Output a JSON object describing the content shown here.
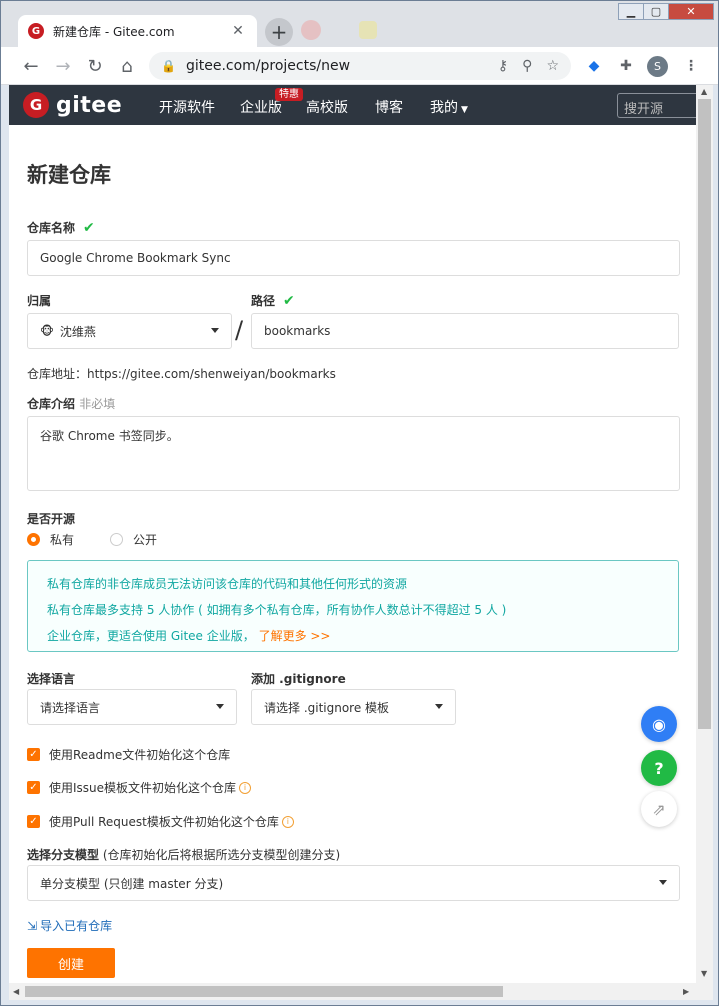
{
  "browser": {
    "tab_title": "新建仓库 - Gitee.com",
    "favicon_letter": "G",
    "url": "gitee.com/projects/new",
    "profile_initial": "S"
  },
  "site_nav": {
    "logo_text": "gitee",
    "logo_letter": "G",
    "items": [
      "开源软件",
      "企业版",
      "高校版",
      "博客",
      "我的"
    ],
    "badge": "特惠",
    "search_placeholder": "搜开源"
  },
  "form": {
    "title": "新建仓库",
    "repo_name_label": "仓库名称",
    "repo_name_value": "Google Chrome Bookmark Sync",
    "owner_label": "归属",
    "owner_value": "沈维燕",
    "path_label": "路径",
    "path_value": "bookmarks",
    "slash": "/",
    "address_label": "仓库地址：",
    "address_value": "https://gitee.com/shenweiyan/bookmarks",
    "desc_label": "仓库介绍",
    "desc_optional": "非必填",
    "desc_value": "谷歌 Chrome 书签同步。",
    "open_label": "是否开源",
    "radio_private": "私有",
    "radio_public": "公开",
    "info_lines": [
      "私有仓库的非仓库成员无法访问该仓库的代码和其他任何形式的资源",
      "私有仓库最多支持 5 人协作 ( 如拥有多个私有仓库，所有协作人数总计不得超过 5 人 )",
      "企业仓库，更适合使用 Gitee 企业版，"
    ],
    "info_link": "了解更多 >>",
    "lang_label": "选择语言",
    "lang_value": "请选择语言",
    "gitignore_label": "添加 .gitignore",
    "gitignore_value": "请选择 .gitignore 模板",
    "checkboxes": [
      "使用Readme文件初始化这个仓库",
      "使用Issue模板文件初始化这个仓库",
      "使用Pull Request模板文件初始化这个仓库"
    ],
    "branch_label": "选择分支模型",
    "branch_hint": "(仓库初始化后将根据所选分支模型创建分支)",
    "branch_value": "单分支模型 (只创建 master 分支)",
    "import_link": "导入已有仓库",
    "create_button": "创建"
  },
  "floating": {
    "help_glyph": "?"
  },
  "colors": {
    "brand": "#c71d23",
    "accent": "#fe7300",
    "info_text": "#10a7a1",
    "nav_bg": "#2e3640"
  }
}
